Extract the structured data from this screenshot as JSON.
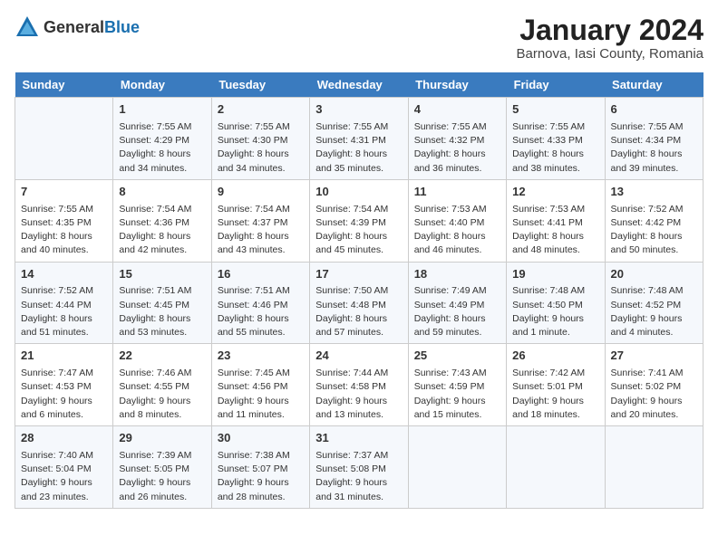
{
  "logo": {
    "general": "General",
    "blue": "Blue"
  },
  "title": "January 2024",
  "subtitle": "Barnova, Iasi County, Romania",
  "days_of_week": [
    "Sunday",
    "Monday",
    "Tuesday",
    "Wednesday",
    "Thursday",
    "Friday",
    "Saturday"
  ],
  "weeks": [
    [
      {
        "num": "",
        "info": ""
      },
      {
        "num": "1",
        "info": "Sunrise: 7:55 AM\nSunset: 4:29 PM\nDaylight: 8 hours\nand 34 minutes."
      },
      {
        "num": "2",
        "info": "Sunrise: 7:55 AM\nSunset: 4:30 PM\nDaylight: 8 hours\nand 34 minutes."
      },
      {
        "num": "3",
        "info": "Sunrise: 7:55 AM\nSunset: 4:31 PM\nDaylight: 8 hours\nand 35 minutes."
      },
      {
        "num": "4",
        "info": "Sunrise: 7:55 AM\nSunset: 4:32 PM\nDaylight: 8 hours\nand 36 minutes."
      },
      {
        "num": "5",
        "info": "Sunrise: 7:55 AM\nSunset: 4:33 PM\nDaylight: 8 hours\nand 38 minutes."
      },
      {
        "num": "6",
        "info": "Sunrise: 7:55 AM\nSunset: 4:34 PM\nDaylight: 8 hours\nand 39 minutes."
      }
    ],
    [
      {
        "num": "7",
        "info": "Sunrise: 7:55 AM\nSunset: 4:35 PM\nDaylight: 8 hours\nand 40 minutes."
      },
      {
        "num": "8",
        "info": "Sunrise: 7:54 AM\nSunset: 4:36 PM\nDaylight: 8 hours\nand 42 minutes."
      },
      {
        "num": "9",
        "info": "Sunrise: 7:54 AM\nSunset: 4:37 PM\nDaylight: 8 hours\nand 43 minutes."
      },
      {
        "num": "10",
        "info": "Sunrise: 7:54 AM\nSunset: 4:39 PM\nDaylight: 8 hours\nand 45 minutes."
      },
      {
        "num": "11",
        "info": "Sunrise: 7:53 AM\nSunset: 4:40 PM\nDaylight: 8 hours\nand 46 minutes."
      },
      {
        "num": "12",
        "info": "Sunrise: 7:53 AM\nSunset: 4:41 PM\nDaylight: 8 hours\nand 48 minutes."
      },
      {
        "num": "13",
        "info": "Sunrise: 7:52 AM\nSunset: 4:42 PM\nDaylight: 8 hours\nand 50 minutes."
      }
    ],
    [
      {
        "num": "14",
        "info": "Sunrise: 7:52 AM\nSunset: 4:44 PM\nDaylight: 8 hours\nand 51 minutes."
      },
      {
        "num": "15",
        "info": "Sunrise: 7:51 AM\nSunset: 4:45 PM\nDaylight: 8 hours\nand 53 minutes."
      },
      {
        "num": "16",
        "info": "Sunrise: 7:51 AM\nSunset: 4:46 PM\nDaylight: 8 hours\nand 55 minutes."
      },
      {
        "num": "17",
        "info": "Sunrise: 7:50 AM\nSunset: 4:48 PM\nDaylight: 8 hours\nand 57 minutes."
      },
      {
        "num": "18",
        "info": "Sunrise: 7:49 AM\nSunset: 4:49 PM\nDaylight: 8 hours\nand 59 minutes."
      },
      {
        "num": "19",
        "info": "Sunrise: 7:48 AM\nSunset: 4:50 PM\nDaylight: 9 hours\nand 1 minute."
      },
      {
        "num": "20",
        "info": "Sunrise: 7:48 AM\nSunset: 4:52 PM\nDaylight: 9 hours\nand 4 minutes."
      }
    ],
    [
      {
        "num": "21",
        "info": "Sunrise: 7:47 AM\nSunset: 4:53 PM\nDaylight: 9 hours\nand 6 minutes."
      },
      {
        "num": "22",
        "info": "Sunrise: 7:46 AM\nSunset: 4:55 PM\nDaylight: 9 hours\nand 8 minutes."
      },
      {
        "num": "23",
        "info": "Sunrise: 7:45 AM\nSunset: 4:56 PM\nDaylight: 9 hours\nand 11 minutes."
      },
      {
        "num": "24",
        "info": "Sunrise: 7:44 AM\nSunset: 4:58 PM\nDaylight: 9 hours\nand 13 minutes."
      },
      {
        "num": "25",
        "info": "Sunrise: 7:43 AM\nSunset: 4:59 PM\nDaylight: 9 hours\nand 15 minutes."
      },
      {
        "num": "26",
        "info": "Sunrise: 7:42 AM\nSunset: 5:01 PM\nDaylight: 9 hours\nand 18 minutes."
      },
      {
        "num": "27",
        "info": "Sunrise: 7:41 AM\nSunset: 5:02 PM\nDaylight: 9 hours\nand 20 minutes."
      }
    ],
    [
      {
        "num": "28",
        "info": "Sunrise: 7:40 AM\nSunset: 5:04 PM\nDaylight: 9 hours\nand 23 minutes."
      },
      {
        "num": "29",
        "info": "Sunrise: 7:39 AM\nSunset: 5:05 PM\nDaylight: 9 hours\nand 26 minutes."
      },
      {
        "num": "30",
        "info": "Sunrise: 7:38 AM\nSunset: 5:07 PM\nDaylight: 9 hours\nand 28 minutes."
      },
      {
        "num": "31",
        "info": "Sunrise: 7:37 AM\nSunset: 5:08 PM\nDaylight: 9 hours\nand 31 minutes."
      },
      {
        "num": "",
        "info": ""
      },
      {
        "num": "",
        "info": ""
      },
      {
        "num": "",
        "info": ""
      }
    ]
  ]
}
